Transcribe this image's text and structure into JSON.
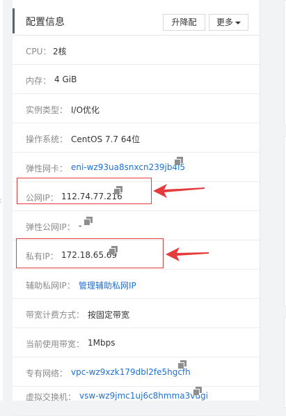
{
  "header": {
    "title": "配置信息",
    "upgrade_label": "升降配",
    "more_label": "更多"
  },
  "rows": [
    {
      "label": "CPU：",
      "value": "2核"
    },
    {
      "label": "内存：",
      "value": "4 GiB"
    },
    {
      "label": "实例类型：",
      "value": "I/O优化"
    },
    {
      "label": "操作系统：",
      "value": "CentOS 7.7 64位"
    },
    {
      "label": "弹性网卡：",
      "value": "eni-wz93ua8snxcn239jb4i5"
    },
    {
      "label": "公网IP：",
      "value": "112.74.77.216"
    },
    {
      "label": "弹性公网IP：",
      "value": "-"
    },
    {
      "label": "私有IP：",
      "value": "172.18.65.69"
    },
    {
      "label": "辅助私网IP：",
      "value": "管理辅助私网IP"
    },
    {
      "label": "带宽计费方式：",
      "value": "按固定带宽"
    },
    {
      "label": "当前使用带宽：",
      "value": "1Mbps"
    },
    {
      "label": "专有网络：",
      "value": "vpc-wz9xzk179dbl2fe5hgcfh"
    },
    {
      "label": "虚拟交换机：",
      "value": "vsw-wz9jmc1uj6c8hmma3vugi"
    }
  ],
  "colors": {
    "link": "#1e6fd6",
    "annotation": "#e43c3c",
    "header_accent": "#5a6270"
  },
  "icons": {
    "copy": "copy-icon",
    "more_caret": "caret-down-icon",
    "collapse": "chevron-left-icon"
  }
}
